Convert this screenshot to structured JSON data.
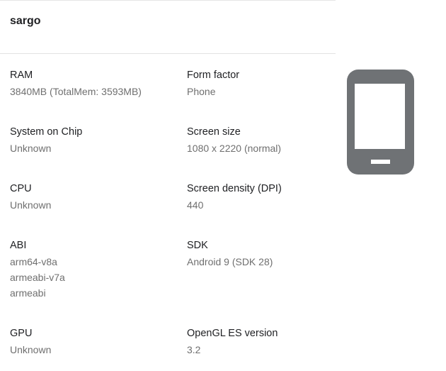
{
  "device": {
    "name": "sargo"
  },
  "specs": {
    "ram": {
      "label": "RAM",
      "values": [
        "3840MB (TotalMem: 3593MB)"
      ]
    },
    "form_factor": {
      "label": "Form factor",
      "values": [
        "Phone"
      ]
    },
    "soc": {
      "label": "System on Chip",
      "values": [
        "Unknown"
      ]
    },
    "screen_size": {
      "label": "Screen size",
      "values": [
        "1080 x 2220 (normal)"
      ]
    },
    "cpu": {
      "label": "CPU",
      "values": [
        "Unknown"
      ]
    },
    "screen_density": {
      "label": "Screen density (DPI)",
      "values": [
        "440"
      ]
    },
    "abi": {
      "label": "ABI",
      "values": [
        "arm64-v8a",
        "armeabi-v7a",
        "armeabi"
      ]
    },
    "sdk": {
      "label": "SDK",
      "values": [
        "Android 9 (SDK 28)"
      ]
    },
    "gpu": {
      "label": "GPU",
      "values": [
        "Unknown"
      ]
    },
    "opengl": {
      "label": "OpenGL ES version",
      "values": [
        "3.2"
      ]
    }
  },
  "icon": {
    "name": "phone-icon",
    "color": "#6f7275"
  }
}
